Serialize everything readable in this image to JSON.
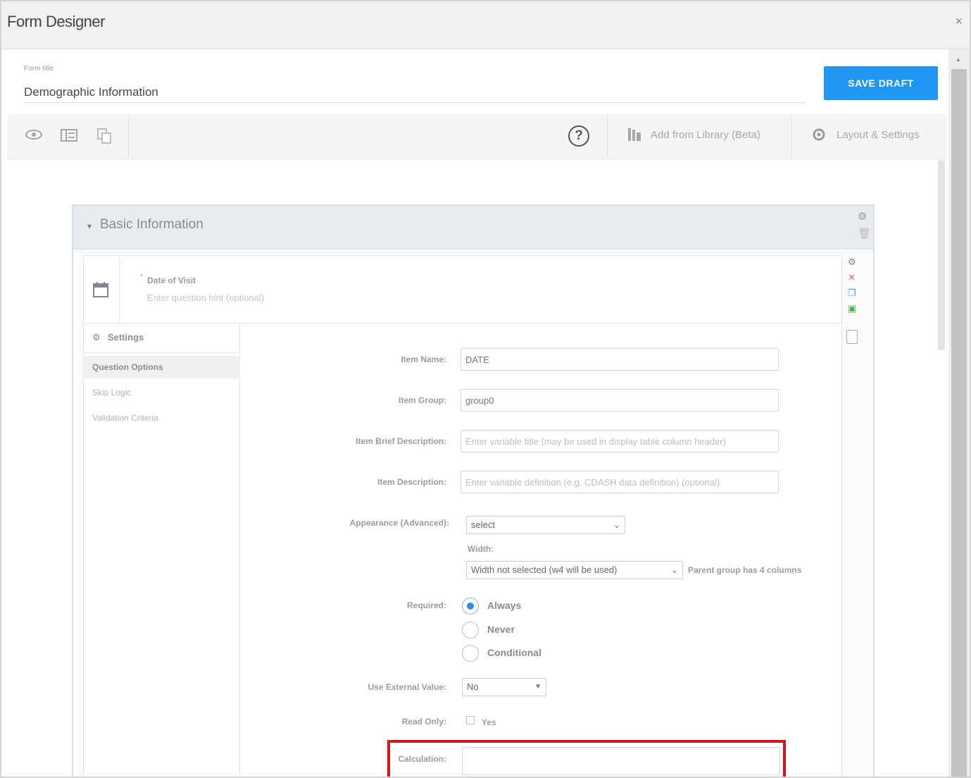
{
  "window": {
    "title": "Form Designer",
    "close_glyph": "×"
  },
  "header": {
    "form_title_label": "Form title",
    "form_title_value": "Demographic Information",
    "save_button": "SAVE DRAFT"
  },
  "toolbar": {
    "left_icons": [
      "eye-icon",
      "list-icon",
      "copy-icon"
    ],
    "help_glyph": "?",
    "add_from_library": "Add from Library (Beta)",
    "layout_settings": "Layout & Settings"
  },
  "section": {
    "toggle_glyph": "▾",
    "title": "Basic Information"
  },
  "question": {
    "required_mark": "*",
    "title": "Date of Visit",
    "hint_placeholder": "Enter question hint (optional)"
  },
  "settings": {
    "heading": "Settings",
    "tabs": [
      "Question Options",
      "Skip Logic",
      "Validation Criteria"
    ],
    "fields": {
      "item_name_label": "Item Name:",
      "item_name_value": "DATE",
      "item_group_label": "Item Group:",
      "item_group_value": "group0",
      "brief_desc_label": "Item Brief Description:",
      "brief_desc_placeholder": "Enter variable title (may be used in display table column header)",
      "description_label": "Item Description:",
      "description_placeholder": "Enter variable definition (e.g. CDASH data definition) (optional)",
      "appearance_label": "Appearance (Advanced):",
      "appearance_value": "select",
      "width_label": "Width:",
      "width_value": "Width not selected (w4 will be used)",
      "width_note": "Parent group has 4 columns",
      "required_label": "Required:",
      "required_options": [
        "Always",
        "Never",
        "Conditional"
      ],
      "required_selected": "Always",
      "external_label": "Use External Value:",
      "external_value": "No",
      "readonly_label": "Read Only:",
      "readonly_option": "Yes",
      "calculation_label": "Calculation:",
      "calculation_value": ""
    }
  },
  "colors": {
    "accent": "#2196f3",
    "highlight": "#d0171e"
  }
}
